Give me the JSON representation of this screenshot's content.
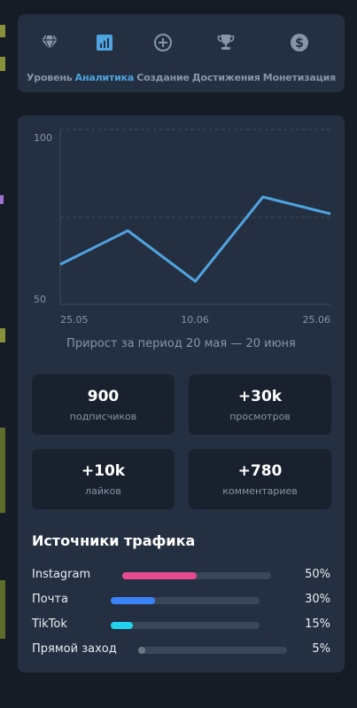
{
  "tabs": [
    {
      "label": "Уровень",
      "icon": "diamond-icon",
      "active": false
    },
    {
      "label": "Аналитика",
      "icon": "bar-chart-icon",
      "active": true
    },
    {
      "label": "Создание",
      "icon": "plus-circle-icon",
      "active": false
    },
    {
      "label": "Достижения",
      "icon": "trophy-icon",
      "active": false
    },
    {
      "label": "Монетизация",
      "icon": "dollar-icon",
      "active": false
    }
  ],
  "colors": {
    "accent": "#4ea3e0",
    "instagram": "#e84a8f",
    "mail": "#3b82f6",
    "tiktok": "#22d3ee",
    "direct": "#6b7686"
  },
  "chart_data": {
    "type": "line",
    "x": [
      "20.05",
      "28.05",
      "05.06",
      "13.06",
      "20.06"
    ],
    "series": [
      {
        "values": [
          60,
          70,
          55,
          80,
          75
        ]
      }
    ],
    "x_tick_labels": [
      "25.05",
      "10.06",
      "25.06"
    ],
    "y_tick_labels": [
      "100",
      "50"
    ],
    "ylim": [
      50,
      100
    ],
    "grid": true
  },
  "analytics": {
    "caption": "Прирост за период 20 мая — 20 июня",
    "stats": [
      {
        "value": "900",
        "label": "подписчиков"
      },
      {
        "value": "+30k",
        "label": "просмотров"
      },
      {
        "value": "+10k",
        "label": "лайков"
      },
      {
        "value": "+780",
        "label": "комментариев"
      }
    ]
  },
  "traffic": {
    "title": "Источники трафика",
    "sources": [
      {
        "name": "Instagram",
        "percent": "50%",
        "share": 0.5
      },
      {
        "name": "Почта",
        "percent": "30%",
        "share": 0.3
      },
      {
        "name": "TikTok",
        "percent": "15%",
        "share": 0.15
      },
      {
        "name": "Прямой заход",
        "percent": "5%",
        "share": 0.05
      }
    ]
  }
}
